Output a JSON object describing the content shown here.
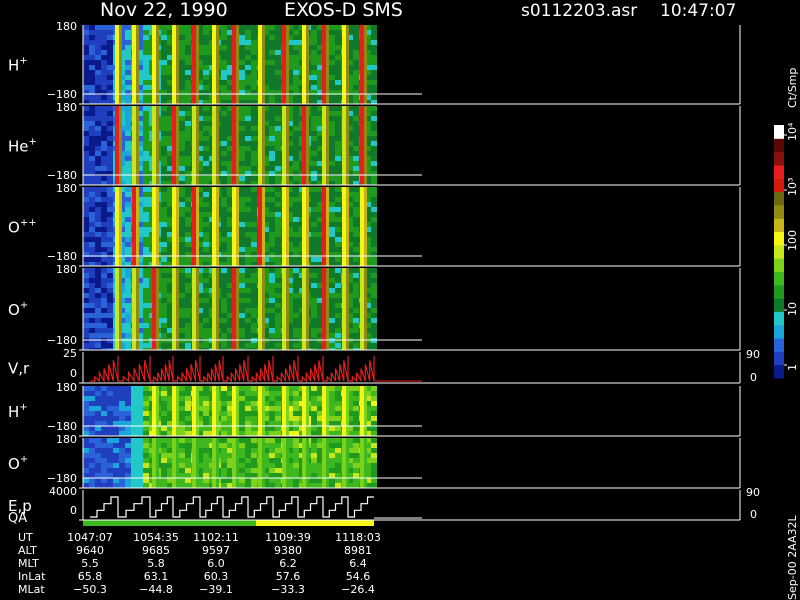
{
  "header": {
    "date": "Nov 22, 1990",
    "instrument": "EXOS-D SMS",
    "file": "s0112203.asr",
    "time": "10:47:07"
  },
  "colorbar": {
    "unit_label": "Ct/Smp",
    "tick_labels": [
      "1",
      "10",
      "100",
      "10³",
      "10⁴"
    ],
    "colors": [
      "#0a1a8a",
      "#1f3fbf",
      "#2a62d8",
      "#1aa6d8",
      "#22c8c8",
      "#107a2a",
      "#1f9a1f",
      "#3eb81e",
      "#7cd21a",
      "#c8e619",
      "#f5f516",
      "#c8b416",
      "#8f8a14",
      "#6b6a10",
      "#d41a0a",
      "#e81e1e",
      "#8a0f0f",
      "#5a0808",
      "#ffffff"
    ]
  },
  "chart_data": [
    {
      "type": "heatmap",
      "panel": "H+",
      "label": "H",
      "superscript": "+",
      "ylim": [
        -180,
        180
      ],
      "tick_top": "180",
      "tick_bottom": "−180"
    },
    {
      "type": "heatmap",
      "panel": "He+",
      "label": "He",
      "superscript": "+",
      "ylim": [
        -180,
        180
      ],
      "tick_top": "180",
      "tick_bottom": "−180"
    },
    {
      "type": "heatmap",
      "panel": "O++",
      "label": "O",
      "superscript": "++",
      "ylim": [
        -180,
        180
      ],
      "tick_top": "180",
      "tick_bottom": "−180"
    },
    {
      "type": "heatmap",
      "panel": "O+",
      "label": "O",
      "superscript": "+",
      "ylim": [
        -180,
        180
      ],
      "tick_top": "180",
      "tick_bottom": "−180"
    },
    {
      "type": "line",
      "panel": "V,r",
      "label": "V,r",
      "ylim": [
        0,
        25
      ],
      "tick_top": "25",
      "tick_bottom": "0",
      "right_top": "90",
      "right_bottom": "0"
    },
    {
      "type": "heatmap",
      "panel": "H+ (2)",
      "label": "H",
      "superscript": "+",
      "ylim": [
        -180,
        180
      ],
      "tick_top": "180",
      "tick_bottom": "−180"
    },
    {
      "type": "heatmap",
      "panel": "O+ (2)",
      "label": "O",
      "superscript": "+",
      "ylim": [
        -180,
        180
      ],
      "tick_top": "180",
      "tick_bottom": "−180"
    },
    {
      "type": "line",
      "panel": "E,p",
      "label": "E,p",
      "label2": "QA",
      "ylim": [
        0,
        4000
      ],
      "tick_top": "4000",
      "tick_bottom": "0",
      "right_top": "90",
      "right_bottom": "0"
    }
  ],
  "x_axis": {
    "rows": [
      {
        "label": "UT",
        "values": [
          "1047:07",
          "1054:35",
          "1102:11",
          "1109:39",
          "1118:03"
        ]
      },
      {
        "label": "ALT",
        "values": [
          "9640",
          "9685",
          "9597",
          "9380",
          "8981"
        ]
      },
      {
        "label": "MLT",
        "values": [
          "5.5",
          "5.8",
          "6.0",
          "6.2",
          "6.4"
        ]
      },
      {
        "label": "InLat",
        "values": [
          "65.8",
          "63.1",
          "60.3",
          "57.6",
          "54.6"
        ]
      },
      {
        "label": "MLat",
        "values": [
          "−50.3",
          "−44.8",
          "−39.1",
          "−33.3",
          "−26.4"
        ]
      }
    ]
  },
  "footer": {
    "stamp": "Sep-00 2AA32L"
  }
}
